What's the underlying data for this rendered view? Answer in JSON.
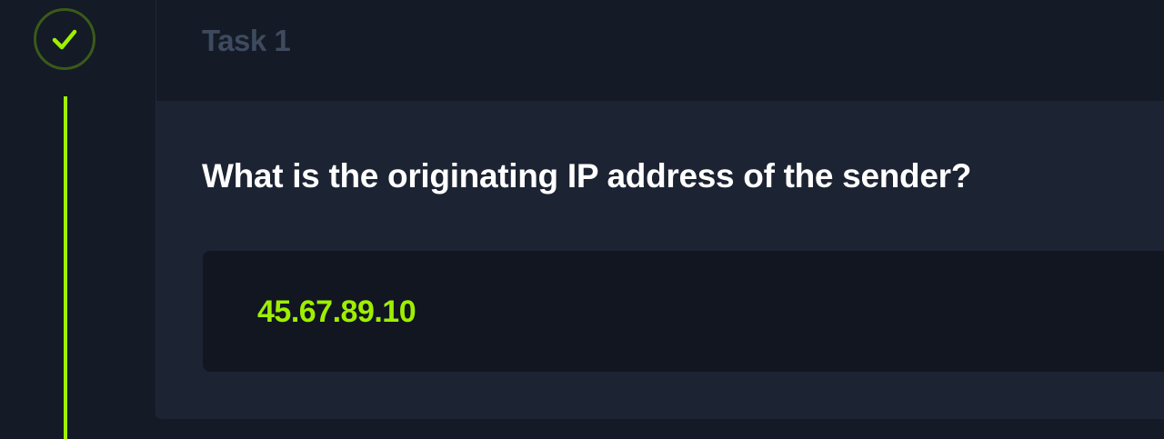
{
  "task": {
    "title": "Task 1",
    "status_icon": "check-icon",
    "question": "What is the originating IP address of the sender?",
    "answer": "45.67.89.10"
  },
  "colors": {
    "accent": "#9fef00",
    "background": "#141a26",
    "panel": "#1c2332",
    "answer_box": "#111621",
    "title_muted": "#3e4a5e"
  }
}
